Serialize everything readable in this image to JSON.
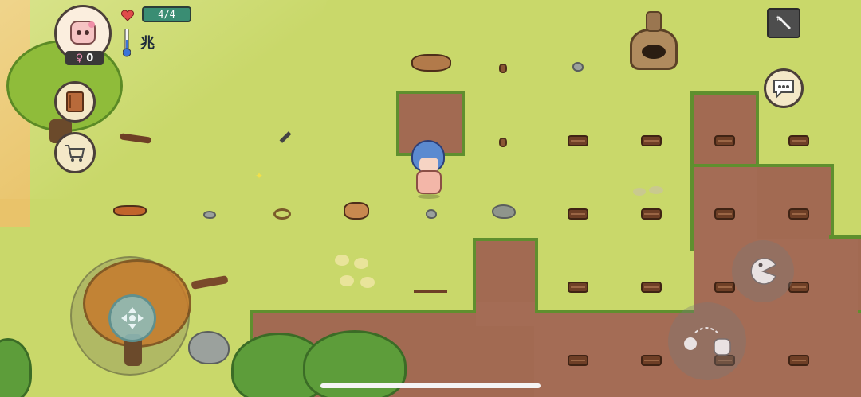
{
  "hud": {
    "health_text": "4/4",
    "temperature_text": "兆",
    "female_count": "0",
    "female_symbol": "♀"
  },
  "icons": {
    "avatar": "character-portrait-icon",
    "journal": "journal-book-icon",
    "shop": "shopping-cart-icon",
    "settings": "wrench-icon",
    "chat": "speech-bubble-icon",
    "heart": "heart-icon",
    "thermometer": "thermometer-icon"
  },
  "colors": {
    "grass": "#c9d86a",
    "dirt": "#a26a52",
    "health_bar": "#3a8d73"
  }
}
